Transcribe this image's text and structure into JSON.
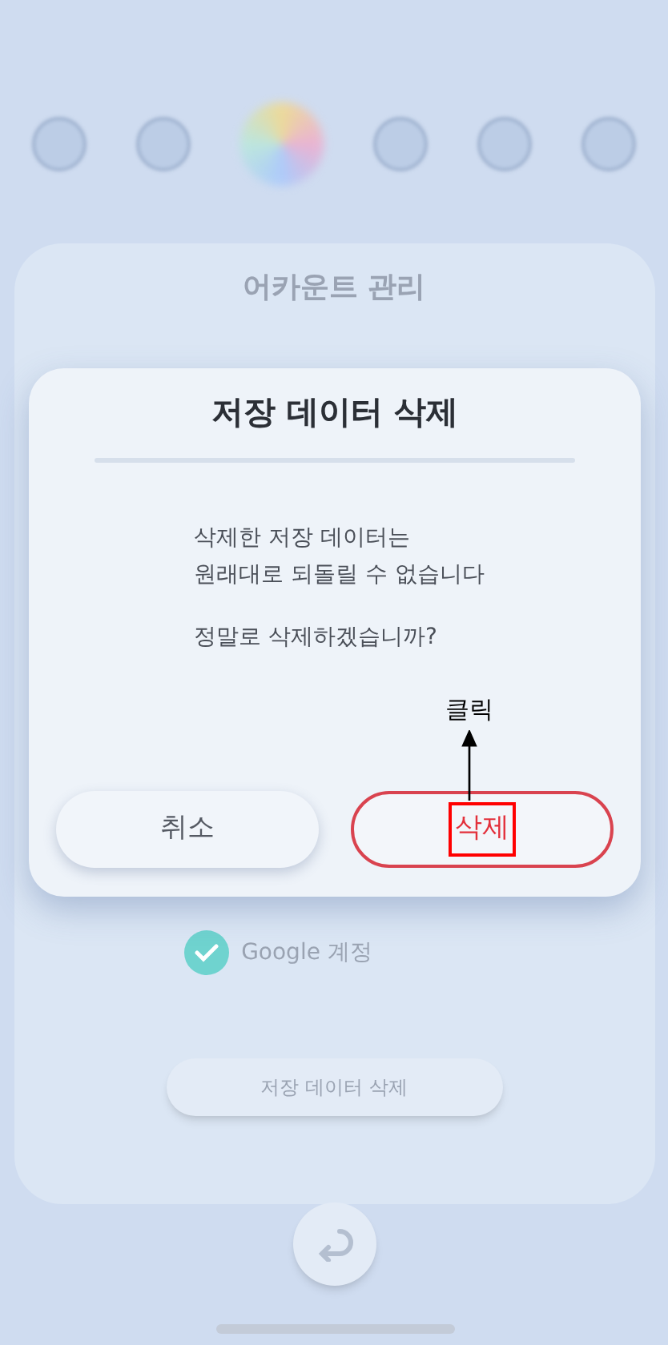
{
  "background": {
    "card_title": "어카운트 관리",
    "account": {
      "label": "Google 계정",
      "checked": true
    },
    "delete_button": "저장 데이터 삭제"
  },
  "dialog": {
    "title": "저장 데이터 삭제",
    "message_lines": [
      "삭제한 저장 데이터는",
      "원래대로 되돌릴 수 없습니다"
    ],
    "question": "정말로 삭제하겠습니까?",
    "buttons": [
      {
        "label": "취소",
        "kind": "cancel"
      },
      {
        "label": "삭제",
        "kind": "danger"
      }
    ]
  },
  "annotation": {
    "label": "클릭"
  }
}
